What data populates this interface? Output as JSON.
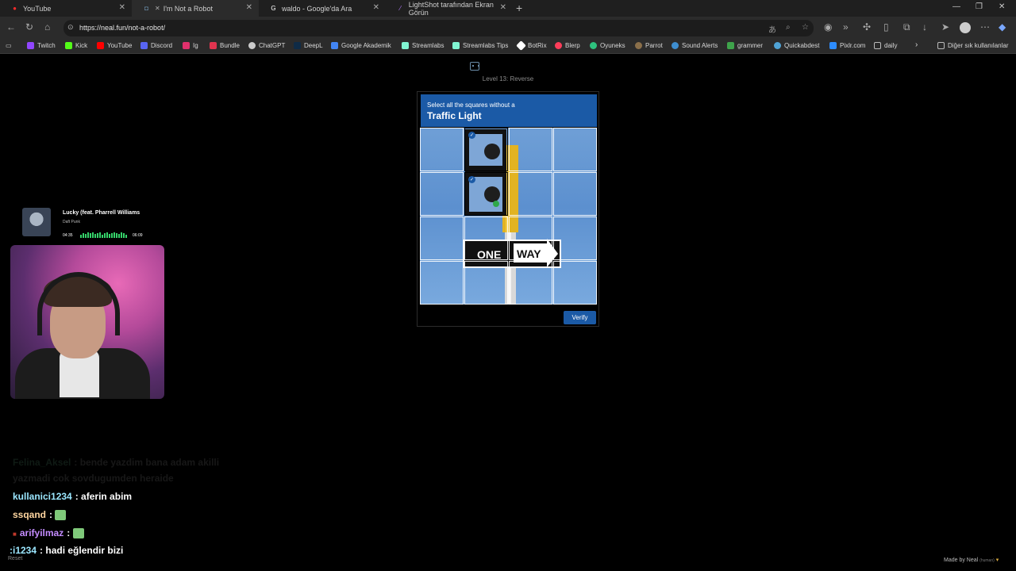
{
  "browser": {
    "tabs": [
      {
        "title": "YouTube",
        "active": false
      },
      {
        "title": "I'm Not a Robot",
        "active": true
      },
      {
        "title": "waldo - Google'da Ara",
        "active": false
      },
      {
        "title": "LightShot tarafından Ekran Görün",
        "active": false
      }
    ],
    "url": "https://neal.fun/not-a-robot/",
    "bookmarks": [
      {
        "label": "Twitch",
        "color": "#9146ff"
      },
      {
        "label": "Kick",
        "color": "#53fc18"
      },
      {
        "label": "YouTube",
        "color": "#ff0000"
      },
      {
        "label": "Discord",
        "color": "#5865f2"
      },
      {
        "label": "Ig",
        "color": "#e1306c"
      },
      {
        "label": "Bundle",
        "color": "#e0344f"
      },
      {
        "label": "ChatGPT",
        "color": "#cccccc"
      },
      {
        "label": "DeepL",
        "color": "#0f2b46"
      },
      {
        "label": "Google Akademik",
        "color": "#4285f4"
      },
      {
        "label": "Streamlabs",
        "color": "#80f5d2"
      },
      {
        "label": "Streamlabs Tips",
        "color": "#80f5d2"
      },
      {
        "label": "BotRix",
        "color": "#ffffff"
      },
      {
        "label": "Blerp",
        "color": "#ff3d5a"
      },
      {
        "label": "Oyuneks",
        "color": "#2ec27e"
      },
      {
        "label": "Parrot",
        "color": "#8a6f4a"
      },
      {
        "label": "Sound Alerts",
        "color": "#3e8ed0"
      },
      {
        "label": "grammer",
        "color": "#3ea34b"
      },
      {
        "label": "Quickabdest",
        "color": "#4fa3d6"
      },
      {
        "label": "Pixlr.com",
        "color": "#2d8cff"
      },
      {
        "label": "daily",
        "color": "#bbbbbb"
      }
    ],
    "other_bookmarks": "Diğer sık kullanılanlar"
  },
  "game": {
    "level": "Level 13: Reverse",
    "instruction": "Select all the squares without a",
    "target": "Traffic Light",
    "verify_label": "Verify",
    "selected_cells": [
      [
        0,
        1
      ],
      [
        1,
        1
      ]
    ],
    "sign_one": "ONE",
    "sign_way": "WAY",
    "reset_label": "Reset",
    "made_by": "Made by Neal",
    "made_by_note": "(human)"
  },
  "now_playing": {
    "song": "Lucky (feat. Pharrell Williams",
    "artist": "Daft Punk",
    "elapsed": "04:35",
    "total": "06:09"
  },
  "chat": [
    {
      "user": "Felina_Aksel",
      "text": ": bende yazdim bana adam akilli",
      "color": "#2b4a3a",
      "faded": true
    },
    {
      "user": "",
      "text": "yazmadi cok sovdugumden heraide",
      "color": "#2b2b2b",
      "faded": true
    },
    {
      "user": "kullanici1234",
      "text": ": aferin abim",
      "color": "#9be7ff"
    },
    {
      "user": "ssqand",
      "text": ":",
      "color": "#ffd6a0",
      "emote": true
    },
    {
      "user": "arifyilmaz",
      "text": ":",
      "color": "#c48cff",
      "emote": true
    },
    {
      "user": ":i1234",
      "text": ": hadi eğlendir bizi",
      "color": "#9be7ff"
    }
  ]
}
